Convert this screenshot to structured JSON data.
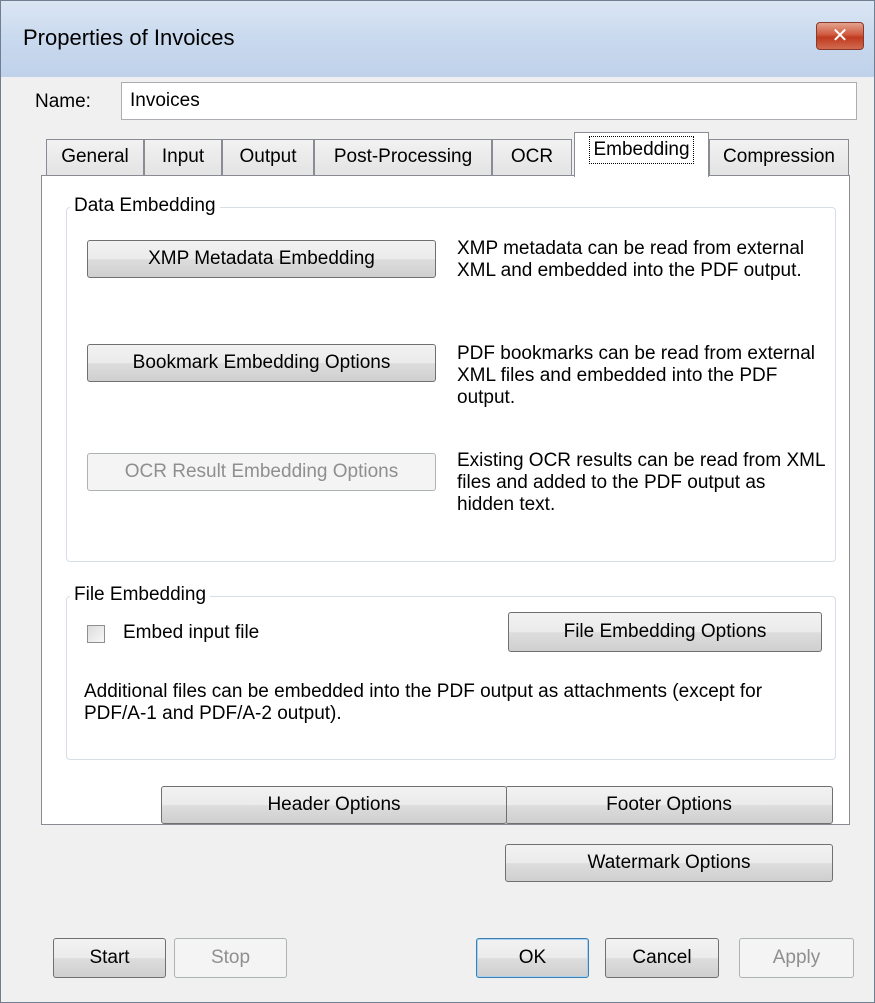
{
  "window": {
    "title": "Properties of Invoices",
    "close_glyph": "✕"
  },
  "name_field": {
    "label": "Name:",
    "value": "Invoices"
  },
  "tabs": [
    {
      "label": "General"
    },
    {
      "label": "Input"
    },
    {
      "label": "Output"
    },
    {
      "label": "Post-Processing"
    },
    {
      "label": "OCR"
    },
    {
      "label": "Embedding",
      "active": true
    },
    {
      "label": "Compression"
    }
  ],
  "data_embedding": {
    "title": "Data Embedding",
    "xmp_button": "XMP Metadata Embedding",
    "xmp_desc": "XMP metadata can be read from external XML and embedded into the PDF output.",
    "bookmark_button": "Bookmark Embedding Options",
    "bookmark_desc": "PDF bookmarks can be read from external XML files and embedded into the PDF output.",
    "ocr_button": "OCR Result Embedding Options",
    "ocr_desc": "Existing OCR results can be read from XML files and added to the PDF output as hidden text."
  },
  "file_embedding": {
    "title": "File Embedding",
    "checkbox_label": "Embed input file",
    "checkbox_checked": false,
    "options_button": "File Embedding Options",
    "desc": "Additional files can be embedded into the PDF output as attachments (except for PDF/A-1 and PDF/A-2 output)."
  },
  "extra_buttons": {
    "header": "Header Options",
    "footer": "Footer Options",
    "watermark": "Watermark Options"
  },
  "footer_buttons": {
    "start": "Start",
    "stop": "Stop",
    "ok": "OK",
    "cancel": "Cancel",
    "apply": "Apply"
  }
}
